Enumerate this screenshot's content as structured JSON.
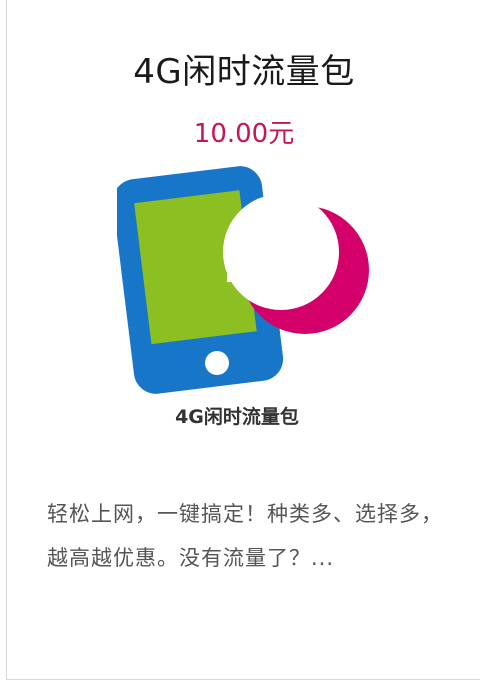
{
  "product": {
    "title": "4G闲时流量包",
    "price": "10.00元",
    "image_caption": "4G闲时流量包",
    "description": "轻松上网，一键搞定！种类多、选择多，越高越优惠。没有流量了？..."
  },
  "colors": {
    "price": "#c8145a",
    "phone_body": "#1876c9",
    "phone_screen": "#8cbf22",
    "moon": "#d4006a"
  },
  "icons": [
    "phone-icon",
    "moon-cloud-icon"
  ]
}
